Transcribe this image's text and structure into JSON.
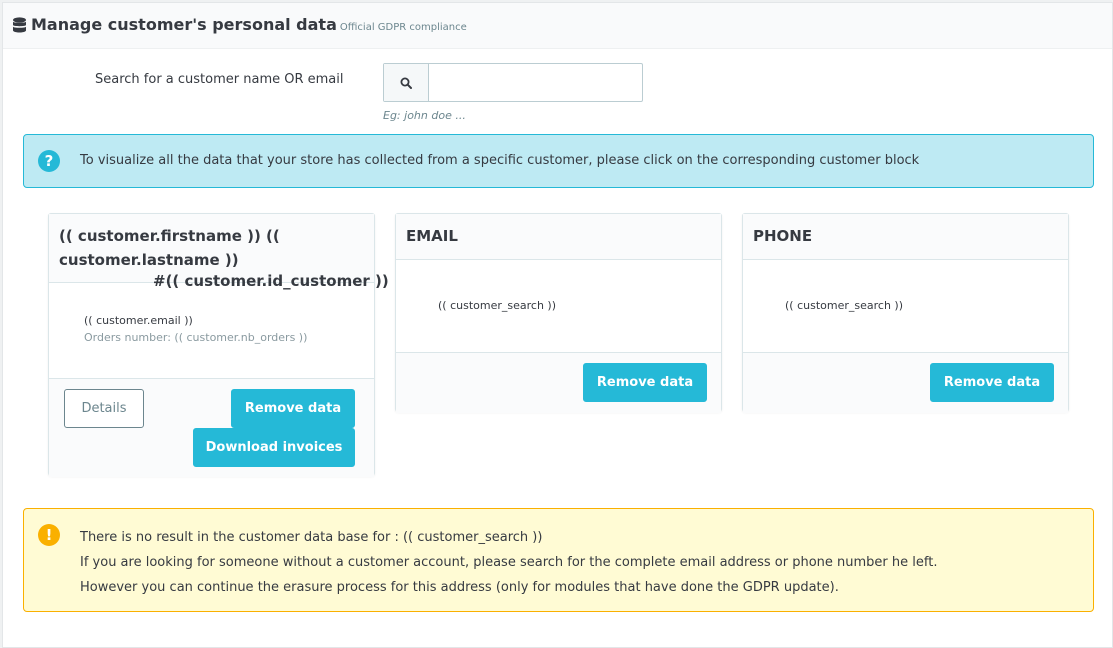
{
  "heading": {
    "title": "Manage customer's personal data",
    "subtitle": "Official GDPR compliance",
    "icon": "database-icon"
  },
  "search": {
    "label": "Search for a customer name OR email",
    "value": "",
    "placeholder": "",
    "help": "Eg: john doe ...",
    "icon": "search-icon"
  },
  "info_alert": {
    "icon": "question-circle-icon",
    "text": "To visualize all the data that your store has collected from a specific customer, please click on the corresponding customer block"
  },
  "customer_card": {
    "name": "(( customer.firstname )) (( customer.lastname ))",
    "id": "#(( customer.id_customer ))",
    "email": "(( customer.email ))",
    "orders": "Orders number: (( customer.nb_orders ))",
    "details_label": "Details",
    "remove_label": "Remove data",
    "download_label": "Download invoices"
  },
  "email_card": {
    "title": "EMAIL",
    "search_value": "(( customer_search ))",
    "remove_label": "Remove data"
  },
  "phone_card": {
    "title": "PHONE",
    "search_value": "(( customer_search ))",
    "remove_label": "Remove data"
  },
  "warning_alert": {
    "icon": "exclamation-circle-icon",
    "lines": [
      "There is no result in the customer data base for : (( customer_search ))",
      "If you are looking for someone without a customer account, please search for the complete email address or phone number he left.",
      "However you can continue the erasure process for this address (only for modules that have done the GDPR update)."
    ]
  },
  "colors": {
    "primary": "#25b9d7",
    "info_bg": "#beeaf3",
    "warning_bg": "#fffbd4",
    "warning_border": "#fab000",
    "text": "#363a41",
    "muted": "#6c868e"
  }
}
